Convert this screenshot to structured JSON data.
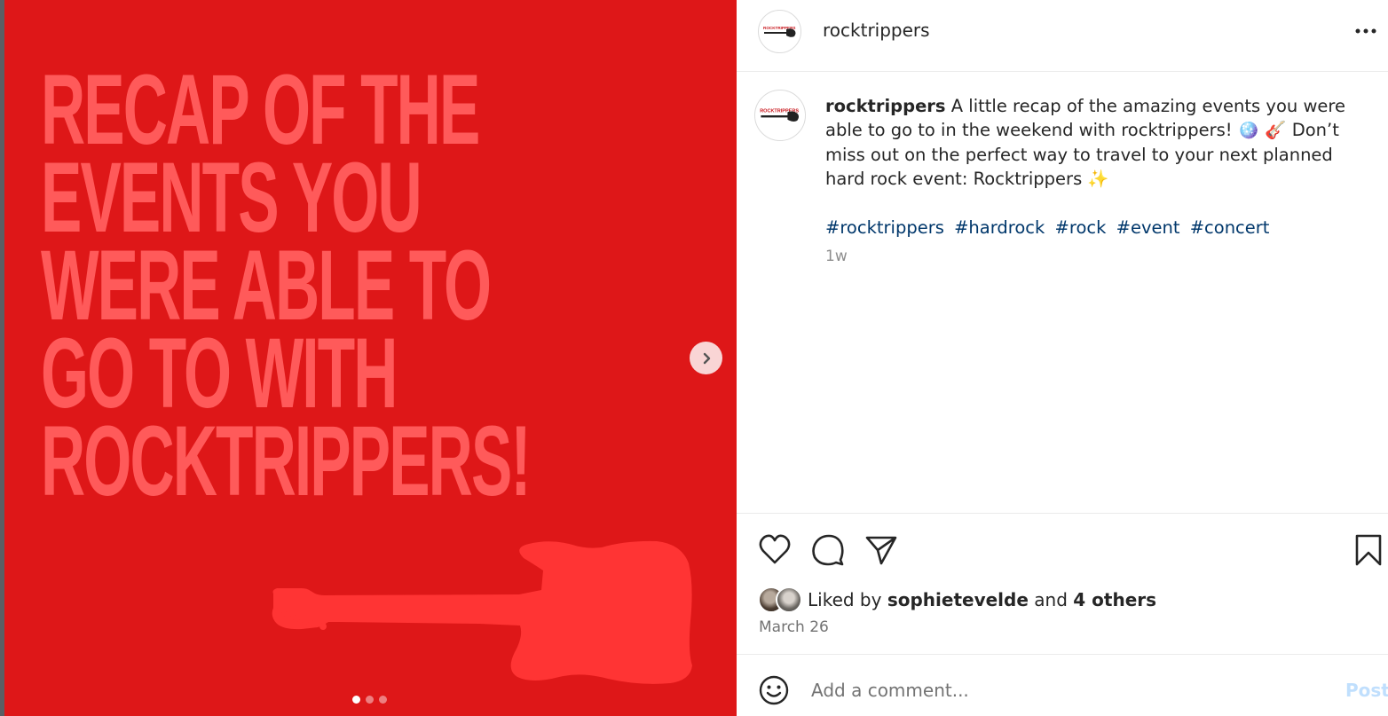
{
  "colors": {
    "media_background": "#de1718",
    "headline_text": "#ff5a5a",
    "guitar": "#ff3434",
    "hashtag": "#00376b",
    "post_button_disabled": "#c0dffd"
  },
  "media": {
    "headline_lines": [
      "RECAP OF THE",
      "EVENTS YOU",
      "WERE ABLE TO",
      "GO TO WITH",
      "ROCKTRIPPERS!"
    ],
    "carousel": {
      "slide_count": 3,
      "active_index": 0
    },
    "next_icon": "chevron-right-icon"
  },
  "header": {
    "username": "rocktrippers",
    "avatar_logo_text": "ROCKTRIPPERS",
    "more_icon": "more-horizontal-icon"
  },
  "caption": {
    "username": "rocktrippers",
    "text": "A little recap of the amazing events you were able to go to in the weekend with rocktrippers! 🪩 🎸  Don’t miss out on the perfect way to travel to your next planned hard rock event: Rocktrippers ✨",
    "hashtags": [
      "#rocktrippers",
      "#hardrock",
      "#rock",
      "#event",
      "#concert"
    ],
    "age": "1w"
  },
  "actions": {
    "icons": [
      "heart-icon",
      "comment-icon",
      "share-icon",
      "bookmark-icon"
    ],
    "liked_prefix": "Liked by",
    "liked_user": "sophietevelde",
    "liked_and": "and",
    "liked_others": "4 others",
    "date": "March 26"
  },
  "comment": {
    "placeholder": "Add a comment...",
    "post_label": "Post",
    "emoji_icon": "emoji-icon"
  }
}
